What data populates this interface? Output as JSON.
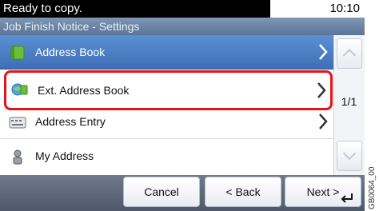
{
  "status": {
    "message": "Ready to copy.",
    "time": "10:10"
  },
  "screen": {
    "title": "Job Finish Notice - Settings"
  },
  "list": {
    "items": [
      {
        "label": "Address Book"
      },
      {
        "label": "Ext. Address Book"
      },
      {
        "label": "Address Entry"
      },
      {
        "label": "My Address"
      }
    ]
  },
  "pager": {
    "page": "1/1"
  },
  "buttons": {
    "cancel": "Cancel",
    "back": "< Back",
    "next": "Next >"
  },
  "side_code": "GB0064_00",
  "colors": {
    "selected_row": "#4b7fc5",
    "highlight": "#e0161b",
    "bottom_bar": "#5c6678"
  }
}
